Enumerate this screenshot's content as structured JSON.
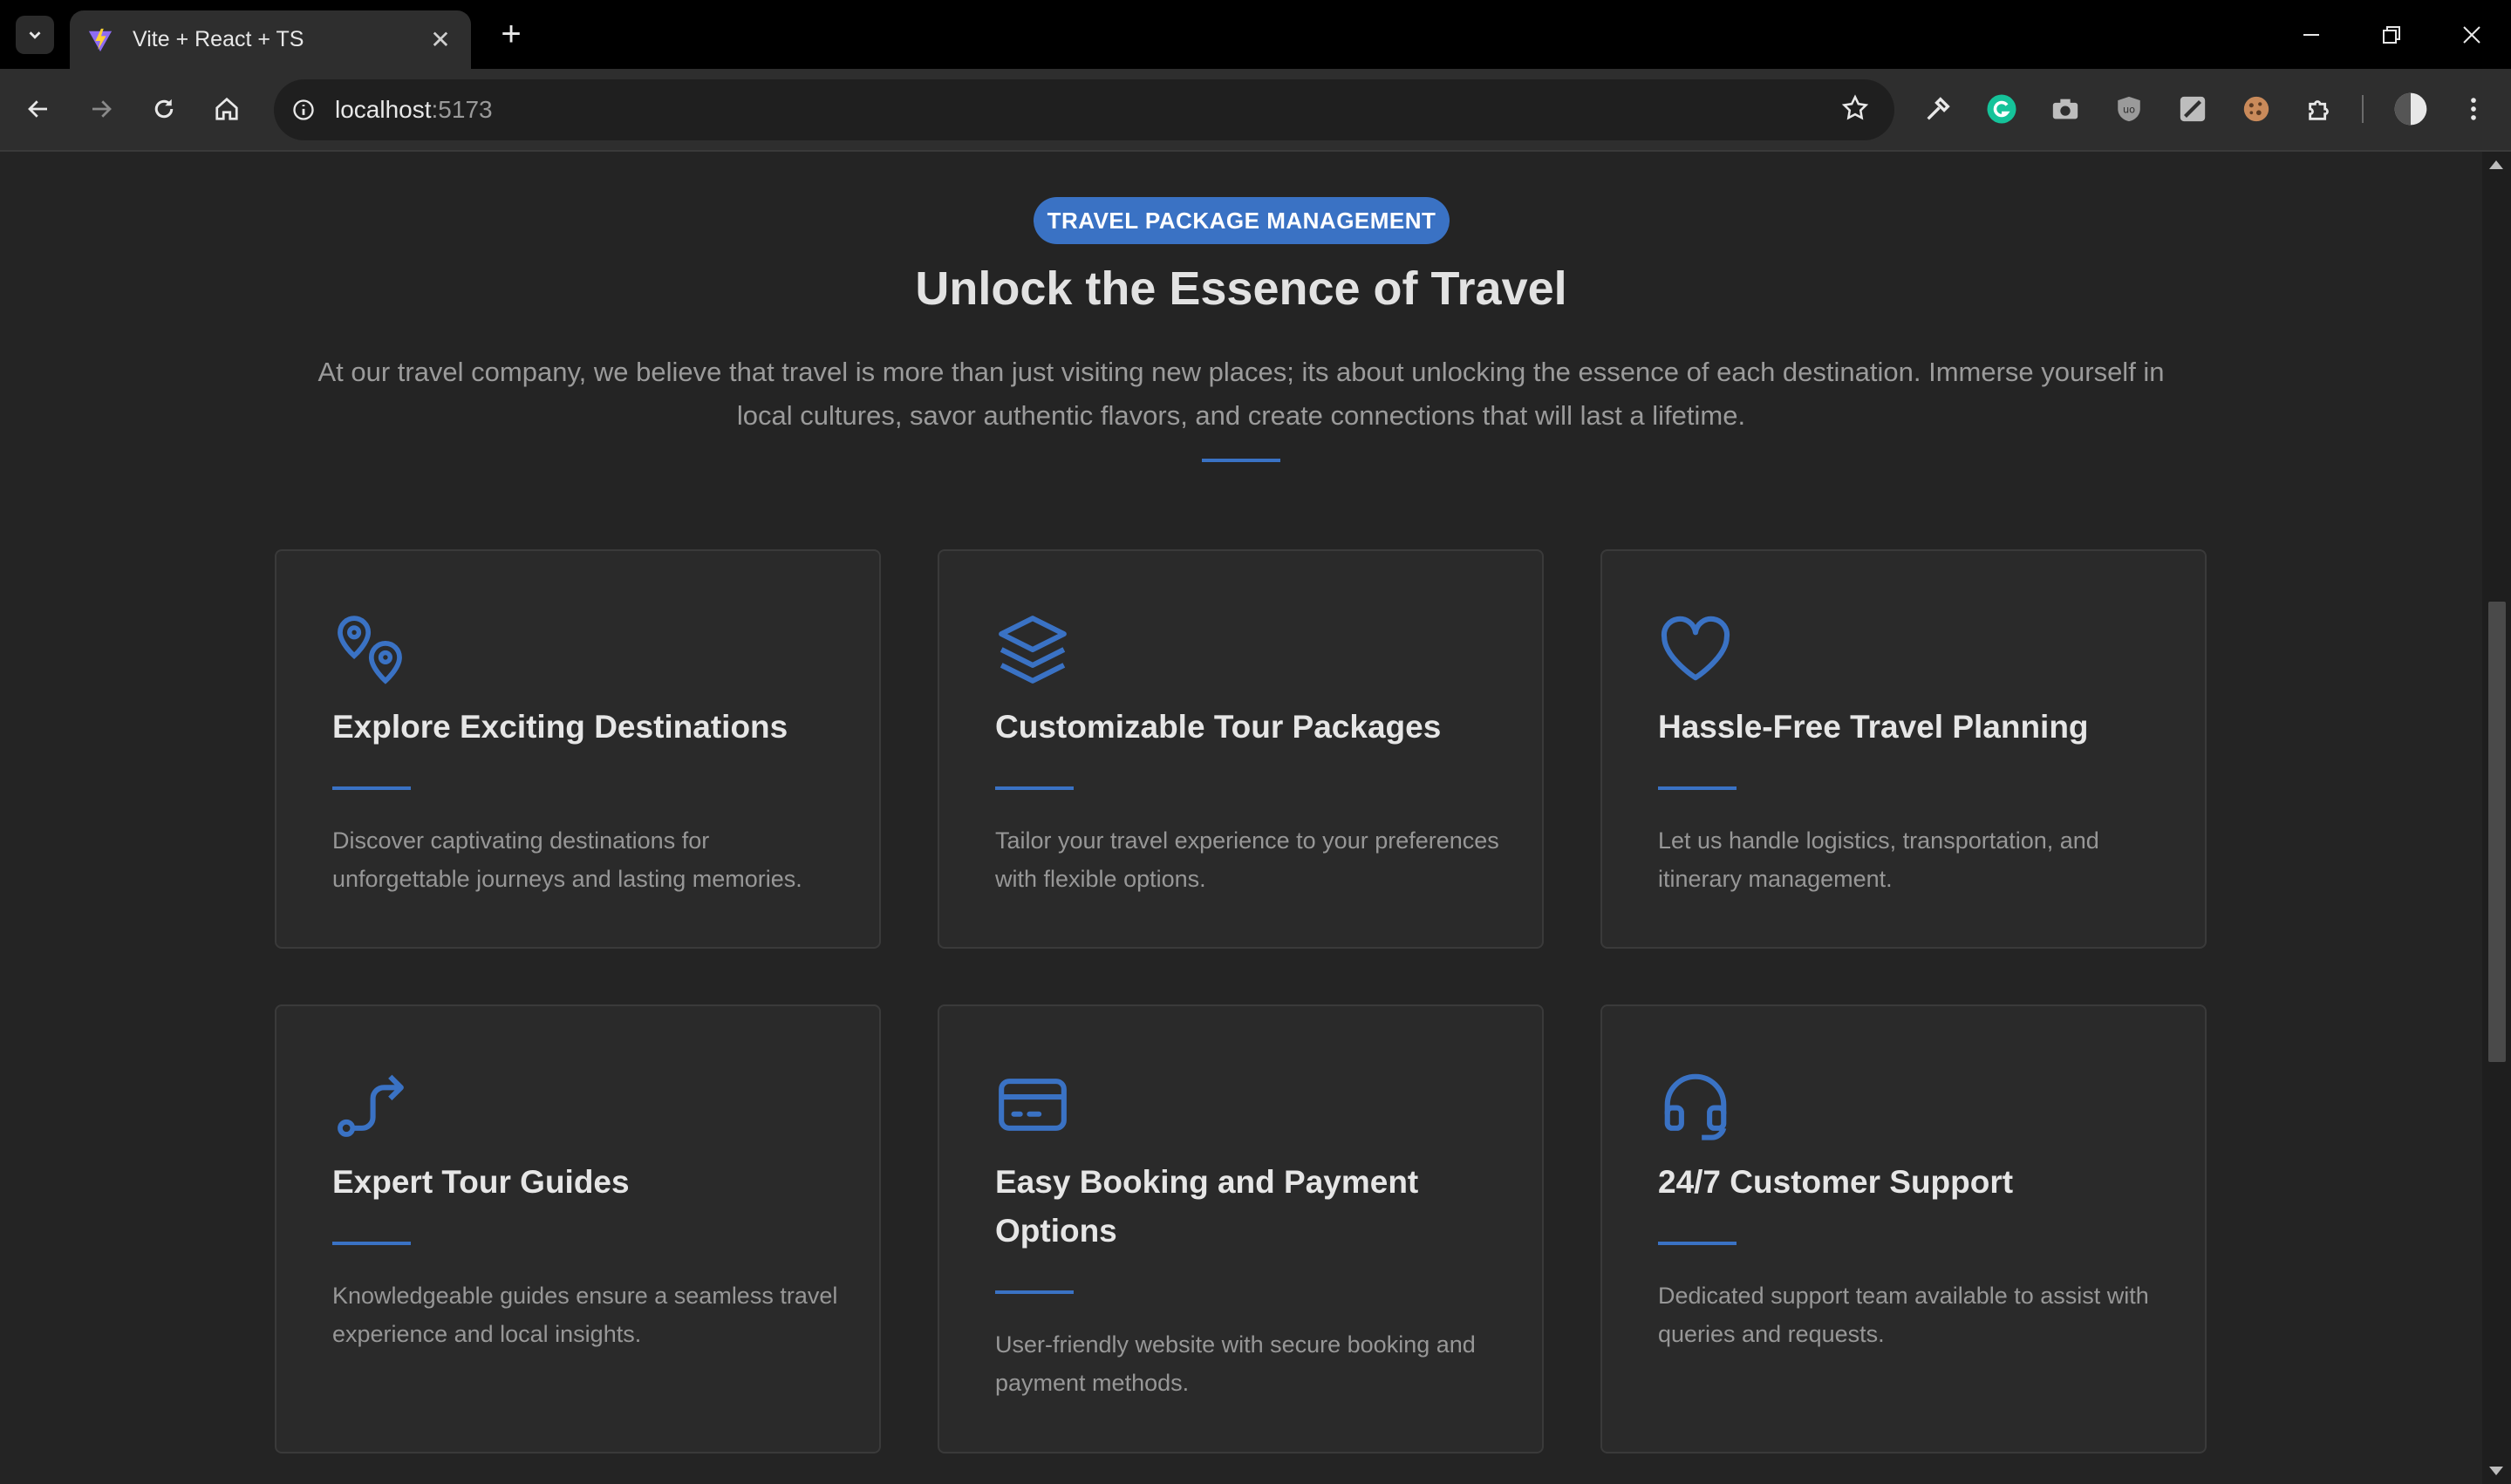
{
  "browser": {
    "tab_title": "Vite + React + TS",
    "url_host": "localhost",
    "url_port": ":5173"
  },
  "page": {
    "badge": "TRAVEL PACKAGE MANAGEMENT",
    "headline": "Unlock the Essence of Travel",
    "intro_line1": "At our travel company, we believe that travel is more than just visiting new places; its about unlocking the essence of each destination. Immerse yourself in",
    "intro_line2": "local cultures, savor authentic flavors, and create connections that will last a lifetime.",
    "accent_color": "#3a72c4",
    "cards": [
      {
        "icon": "map-pins-icon",
        "title": "Explore Exciting Destinations",
        "description": "Discover captivating destinations for unforgettable journeys and lasting memories."
      },
      {
        "icon": "layers-icon",
        "title": "Customizable Tour Packages",
        "description": "Tailor your travel experience to your preferences with flexible options."
      },
      {
        "icon": "heart-icon",
        "title": "Hassle-Free Travel Planning",
        "description": "Let us handle logistics, transportation, and itinerary management."
      },
      {
        "icon": "route-icon",
        "title": "Expert Tour Guides",
        "description": "Knowledgeable guides ensure a seamless travel experience and local insights."
      },
      {
        "icon": "credit-card-icon",
        "title": "Easy Booking and Payment Options",
        "description": "User-friendly website with secure booking and payment methods."
      },
      {
        "icon": "headset-icon",
        "title": "24/7 Customer Support",
        "description": "Dedicated support team available to assist with queries and requests."
      }
    ]
  }
}
